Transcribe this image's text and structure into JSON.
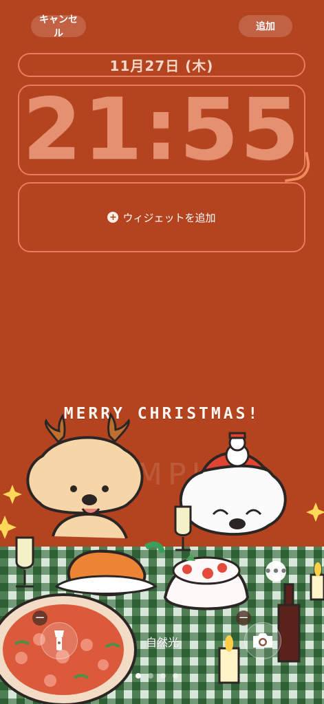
{
  "top_bar": {
    "cancel": "キャンセル",
    "add": "追加"
  },
  "lock_screen": {
    "date": "11月27日 (木)",
    "time": "21:55",
    "add_widget": "ウィジェットを追加"
  },
  "wallpaper": {
    "greeting": "MERRY CHRISTMAS!",
    "watermark": "SAMPLE"
  },
  "controls": {
    "left_action_icon": "flashlight-icon",
    "right_action_icon": "camera-icon",
    "filter_label": "自然光",
    "more_icon": "more-icon"
  },
  "page_indicator": {
    "count": 4,
    "active": 1
  }
}
